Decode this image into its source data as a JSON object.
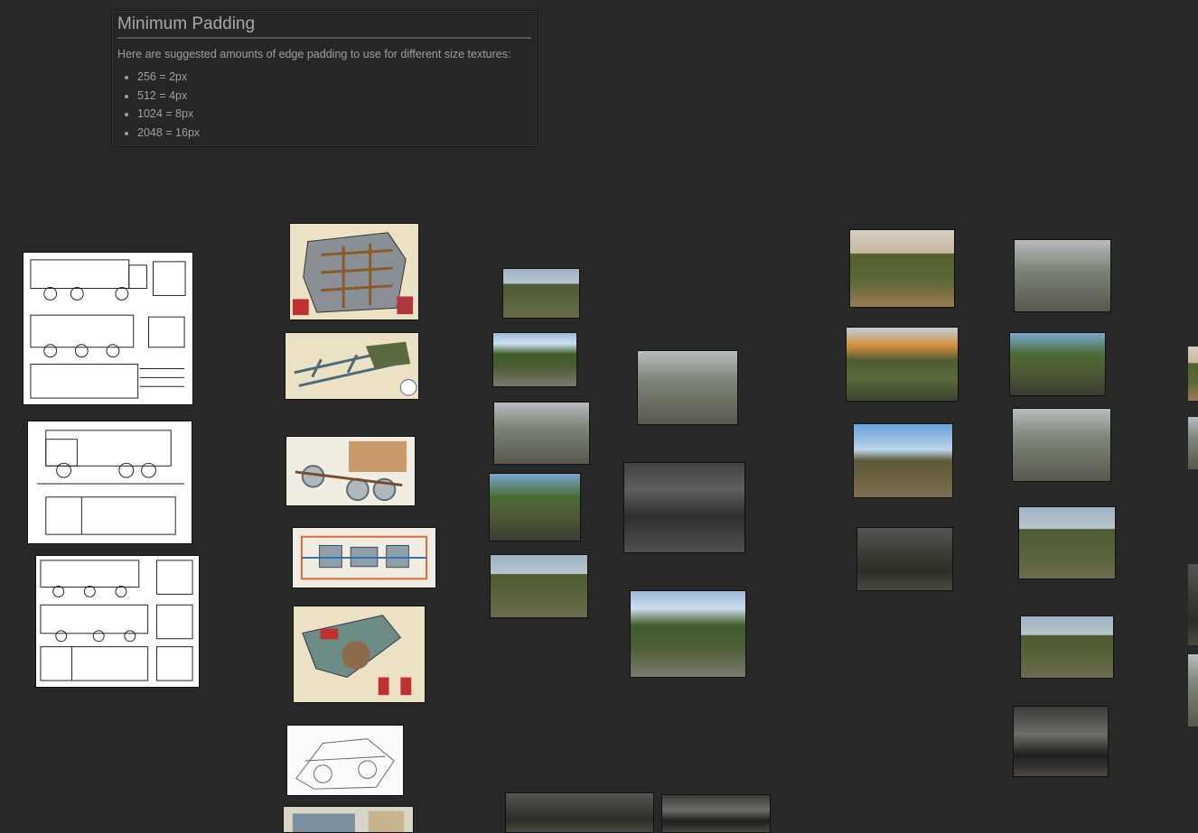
{
  "note": {
    "title": "Minimum Padding",
    "description": "Here are suggested amounts of edge padding to use for different size textures:",
    "items": [
      "256 = 2px",
      "512 = 4px",
      "1024 = 8px",
      "2048 = 16px"
    ]
  },
  "colors": {
    "background": "#282828",
    "note_text": "#a0a0a0",
    "note_rule": "#555555"
  }
}
